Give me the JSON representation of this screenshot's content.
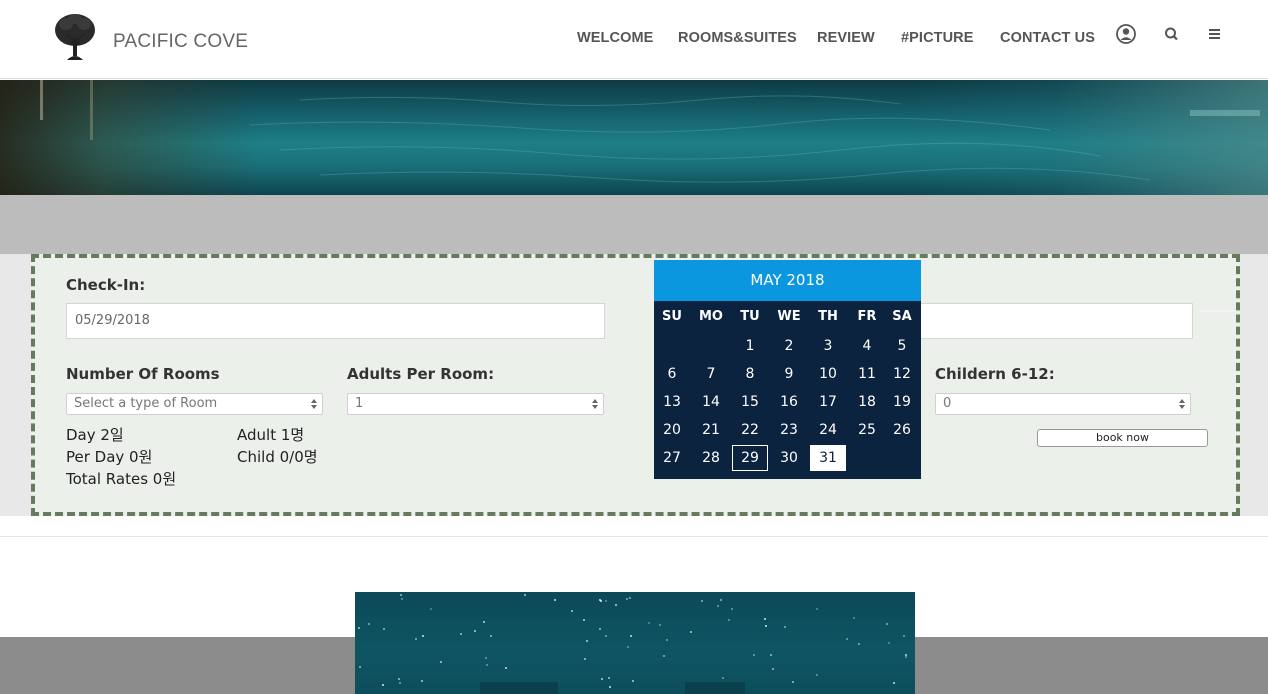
{
  "header": {
    "brand": "PACIFIC COVE",
    "nav": {
      "welcome": "WELCOME",
      "rooms": "ROOMS&SUITES",
      "review": "REVIEW",
      "picture": "#PICTURE",
      "contact": "CONTACT US"
    },
    "icons": [
      "user-icon",
      "search-icon",
      "menu-icon"
    ]
  },
  "booking": {
    "checkin_label": "Check-In:",
    "checkin_value": "05/29/2018",
    "rooms_label": "Number Of Rooms",
    "rooms_placeholder": "Select a type of Room",
    "adults_label": "Adults Per Room:",
    "adults_value": "1",
    "children_label": "Childern 6-12:",
    "children_value": "0",
    "day_text": "Day 2일",
    "per_day_text": "Per Day 0원",
    "total_text": "Total Rates 0원",
    "adult_text": "Adult 1명",
    "child_text": "Child 0/0명",
    "book_button": "book now"
  },
  "calendar": {
    "title": "MAY 2018",
    "weekdays": [
      "SU",
      "MO",
      "TU",
      "WE",
      "TH",
      "FR",
      "SA"
    ],
    "days": [
      "1",
      "2",
      "3",
      "4",
      "5",
      "6",
      "7",
      "8",
      "9",
      "10",
      "11",
      "12",
      "13",
      "14",
      "15",
      "16",
      "17",
      "18",
      "19",
      "20",
      "21",
      "22",
      "23",
      "24",
      "25",
      "26",
      "27",
      "28",
      "29",
      "30",
      "31"
    ],
    "selected_day": "29",
    "highlighted_day": "31"
  },
  "colors": {
    "calendar_header": "#0a97e0",
    "calendar_body": "#0c2340",
    "panel_bg": "#ebf0ea",
    "panel_border": "#667a5e",
    "gray_band": "#bcbcbc"
  }
}
